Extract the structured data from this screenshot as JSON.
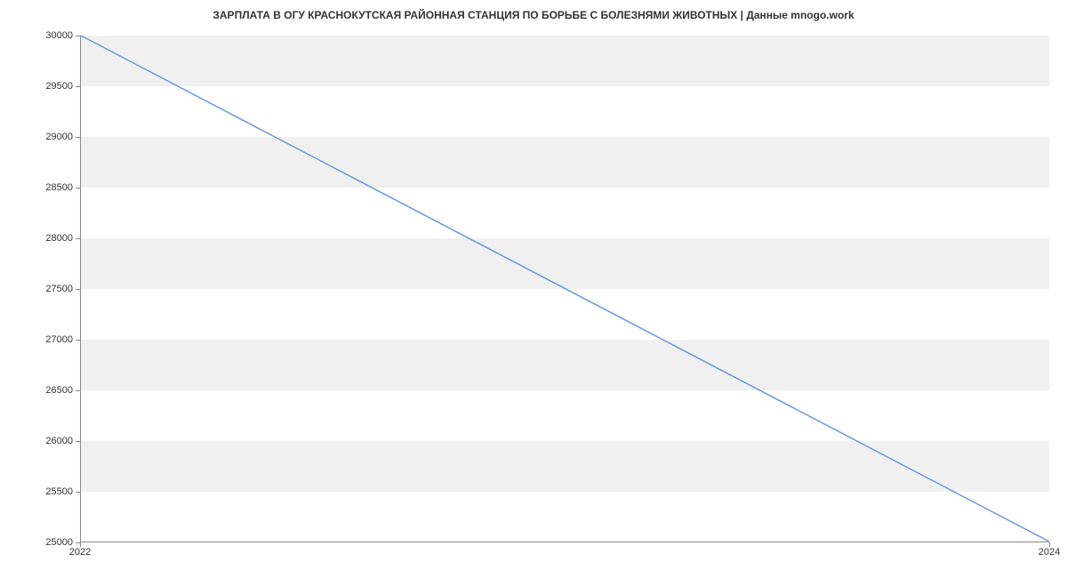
{
  "chart_data": {
    "type": "line",
    "title": "ЗАРПЛАТА В ОГУ  КРАСНОКУТСКАЯ РАЙОННАЯ СТАНЦИЯ ПО БОРЬБЕ С БОЛЕЗНЯМИ ЖИВОТНЫХ | Данные mnogo.work",
    "x": [
      2022,
      2024
    ],
    "values": [
      30000,
      25000
    ],
    "xlabel": "",
    "ylabel": "",
    "xlim": [
      2022,
      2024
    ],
    "ylim": [
      25000,
      30000
    ],
    "x_ticks": [
      2022,
      2024
    ],
    "y_ticks": [
      25000,
      25500,
      26000,
      26500,
      27000,
      27500,
      28000,
      28500,
      29000,
      29500,
      30000
    ]
  }
}
